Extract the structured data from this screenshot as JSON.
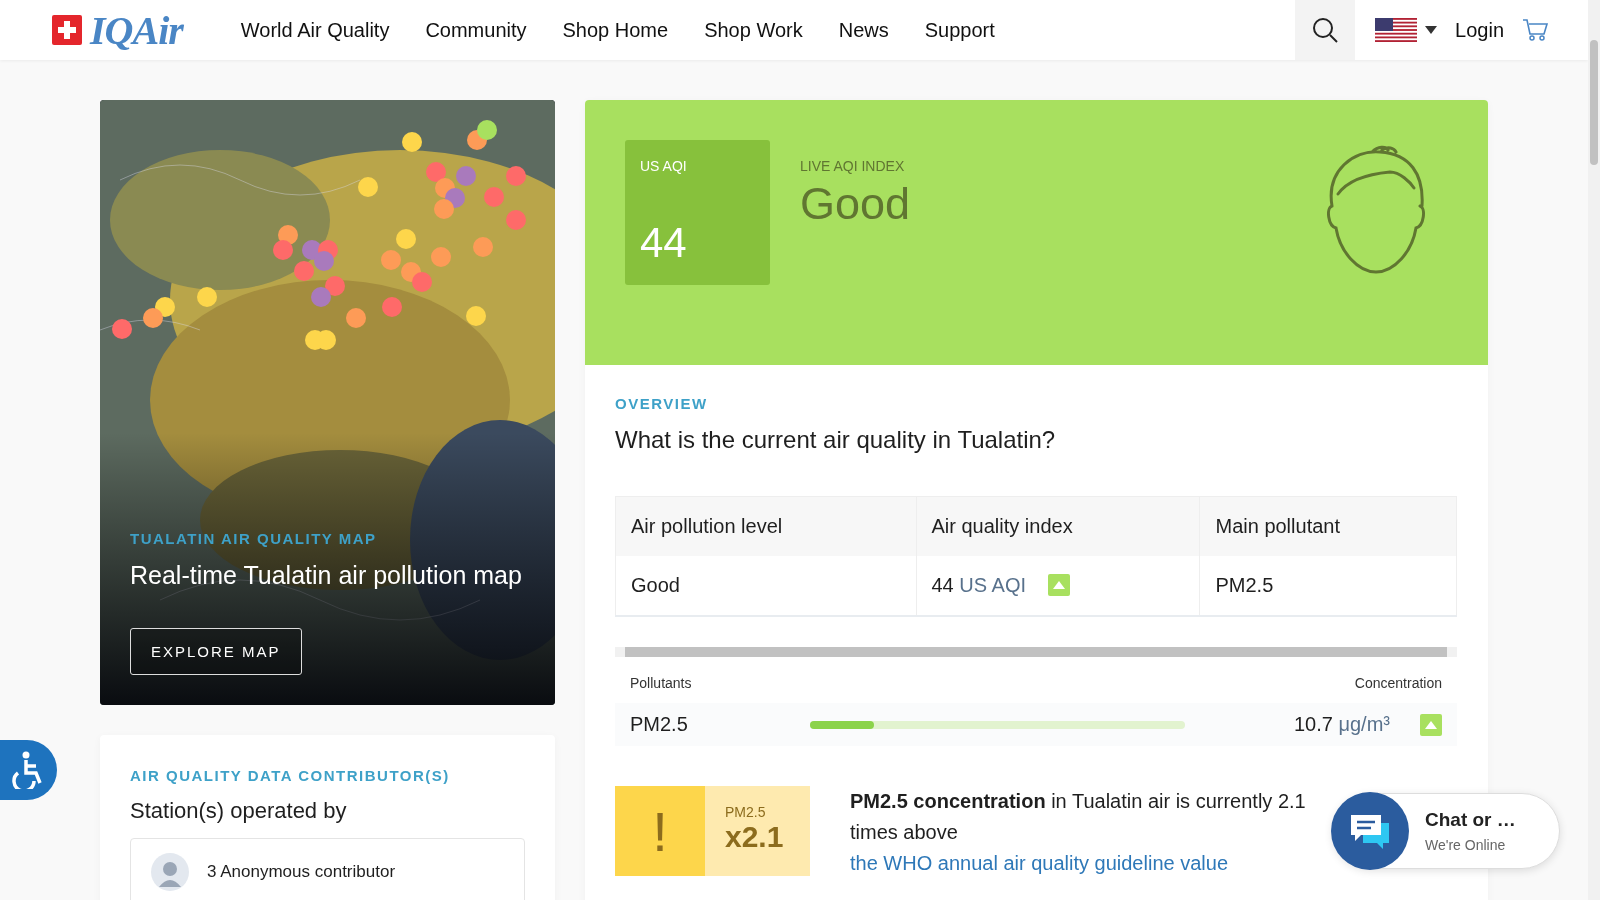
{
  "header": {
    "logo": "IQAir",
    "nav": [
      {
        "label": "World Air Quality"
      },
      {
        "label": "Community"
      },
      {
        "label": "Shop Home"
      },
      {
        "label": "Shop Work"
      },
      {
        "label": "News"
      },
      {
        "label": "Support"
      }
    ],
    "login": "Login"
  },
  "map_card": {
    "eyebrow": "TUALATIN AIR QUALITY MAP",
    "title": "Real-time Tualatin air pollution map",
    "button": "EXPLORE MAP"
  },
  "contributors": {
    "eyebrow": "AIR QUALITY DATA CONTRIBUTOR(S)",
    "title": "Station(s) operated by",
    "items": [
      {
        "name": "3 Anonymous contributor"
      }
    ]
  },
  "aqi": {
    "badge_label": "US AQI",
    "value": "44",
    "index_label": "LIVE AQI INDEX",
    "status": "Good"
  },
  "overview": {
    "eyebrow": "OVERVIEW",
    "title": "What is the current air quality in Tualatin?",
    "table": {
      "columns": [
        "Air pollution level",
        "Air quality index",
        "Main pollutant"
      ],
      "rows": [
        {
          "level": "Good",
          "aqi_value": "44",
          "aqi_unit": "US AQI",
          "rising": true,
          "pollutant": "PM2.5"
        }
      ]
    }
  },
  "pollutants": {
    "label": "Pollutants",
    "concentration_label": "Concentration",
    "rows": [
      {
        "name": "PM2.5",
        "level": 0.17,
        "value": "10.7",
        "unit": "μg/m³",
        "rising": true
      }
    ]
  },
  "alert": {
    "icon": "!",
    "pollutant": "PM2.5",
    "multiplier": "x2.1",
    "text": "**PM2.5 concentration** in Tualatin air is currently 2.1 times above",
    "link": "the WHO annual air quality guideline value"
  },
  "chat": {
    "title": "Chat or …",
    "status": "We're Online"
  }
}
